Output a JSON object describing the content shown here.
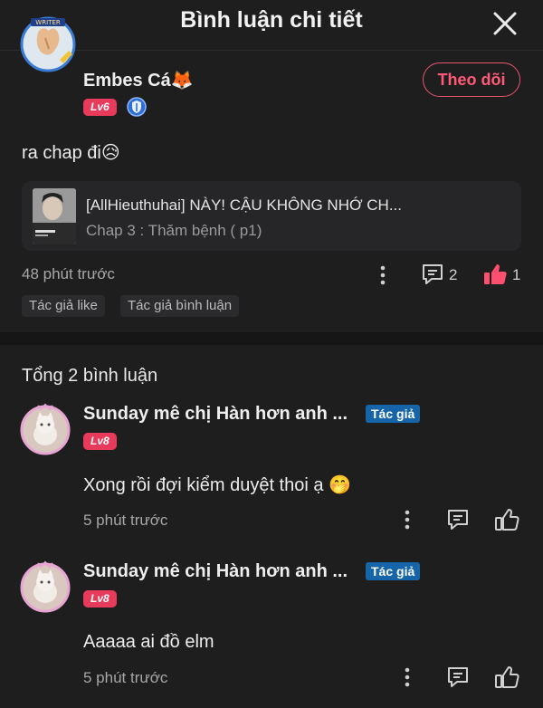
{
  "header": {
    "title": "Bình luận chi tiết"
  },
  "post": {
    "username": "Embes Cá",
    "username_emoji": "🦊",
    "level": "Lv6",
    "follow_label": "Theo dõi",
    "text": "ra chap đi😥",
    "manga": {
      "title": "[AllHieuthuhai] NÀY! CẬU KHÔNG NHỚ CH...",
      "chapter": "Chap 3 : Thăm bệnh ( p1)"
    },
    "time": "48 phút trước",
    "comment_count": "2",
    "like_count": "1",
    "tags": [
      "Tác giả like",
      "Tác giả bình luận"
    ]
  },
  "total_label": "Tổng 2 bình luận",
  "replies": [
    {
      "name": "Sunday mê chị Hàn hơn anh ...",
      "author_tag": "Tác giả",
      "level": "Lv8",
      "text": "Xong rồi đợi kiểm duyệt thoi ạ 🤭",
      "time": "5 phút trước"
    },
    {
      "name": "Sunday mê chị Hàn hơn anh ...",
      "author_tag": "Tác giả",
      "level": "Lv8",
      "text": "Aaaaa ai đồ elm",
      "time": "5 phút trước"
    }
  ],
  "colors": {
    "accent": "#e83a5b",
    "author_tag": "#1565a8",
    "background": "#1e1e1f"
  }
}
